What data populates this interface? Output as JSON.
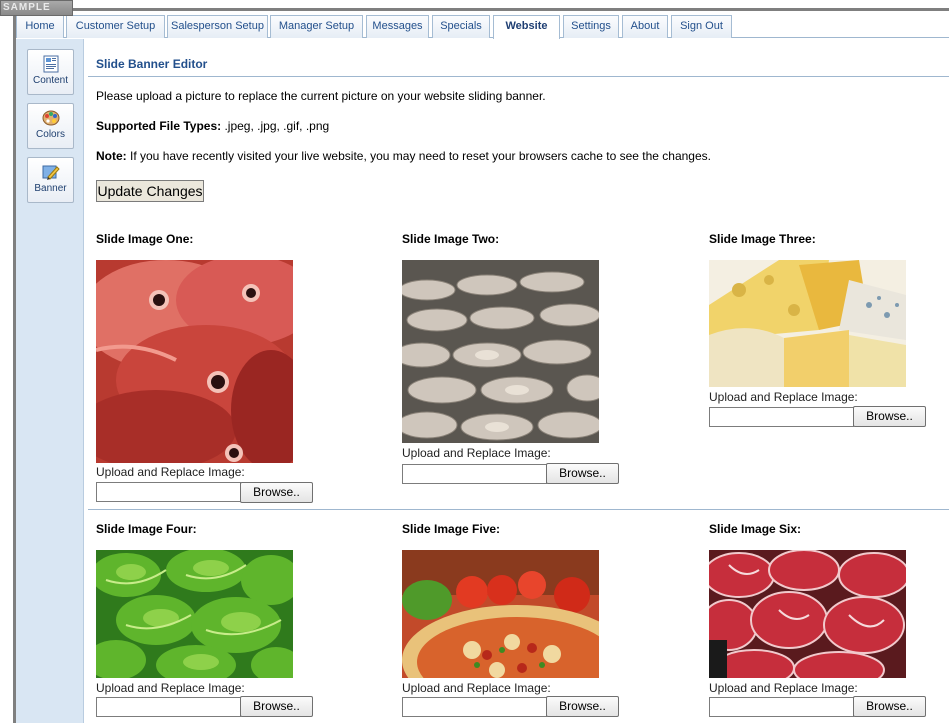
{
  "logo": {
    "text": "SAMPLE"
  },
  "tabs": [
    {
      "label": "Home"
    },
    {
      "label": "Customer Setup"
    },
    {
      "label": "Salesperson Setup"
    },
    {
      "label": "Manager Setup"
    },
    {
      "label": "Messages"
    },
    {
      "label": "Specials"
    },
    {
      "label": "Website",
      "active": true
    },
    {
      "label": "Settings"
    },
    {
      "label": "About"
    },
    {
      "label": "Sign Out"
    }
  ],
  "sidebar": {
    "items": [
      {
        "label": "Content",
        "icon": "content-icon"
      },
      {
        "label": "Colors",
        "icon": "palette-icon"
      },
      {
        "label": "Banner",
        "icon": "banner-edit-icon"
      }
    ]
  },
  "editor": {
    "title": "Slide Banner Editor",
    "intro": "Please upload a picture to replace the current picture on your website sliding banner.",
    "file_types_label": "Supported File Types:",
    "file_types_value": " .jpeg, .jpg, .gif, .png",
    "note_label": "Note:",
    "note_text": " If you have recently visited your live website, you may need to reset your browsers cache to see the changes.",
    "update_button": "Update Changes"
  },
  "slides": [
    {
      "label": "Slide Image One:",
      "image": "red fish",
      "upload_label": "Upload and Replace Image:",
      "browse": "Browse..",
      "value": ""
    },
    {
      "label": "Slide Image Two:",
      "image": "fish fillets on ice",
      "upload_label": "Upload and Replace Image:",
      "browse": "Browse..",
      "value": ""
    },
    {
      "label": "Slide Image Three:",
      "image": "cheese",
      "upload_label": "Upload and Replace Image:",
      "browse": "Browse..",
      "value": ""
    },
    {
      "label": "Slide Image Four:",
      "image": "lettuce",
      "upload_label": "Upload and Replace Image:",
      "browse": "Browse..",
      "value": ""
    },
    {
      "label": "Slide Image Five:",
      "image": "pizza and vegetables",
      "upload_label": "Upload and Replace Image:",
      "browse": "Browse..",
      "value": ""
    },
    {
      "label": "Slide Image Six:",
      "image": "raw steaks",
      "upload_label": "Upload and Replace Image:",
      "browse": "Browse..",
      "value": ""
    }
  ]
}
